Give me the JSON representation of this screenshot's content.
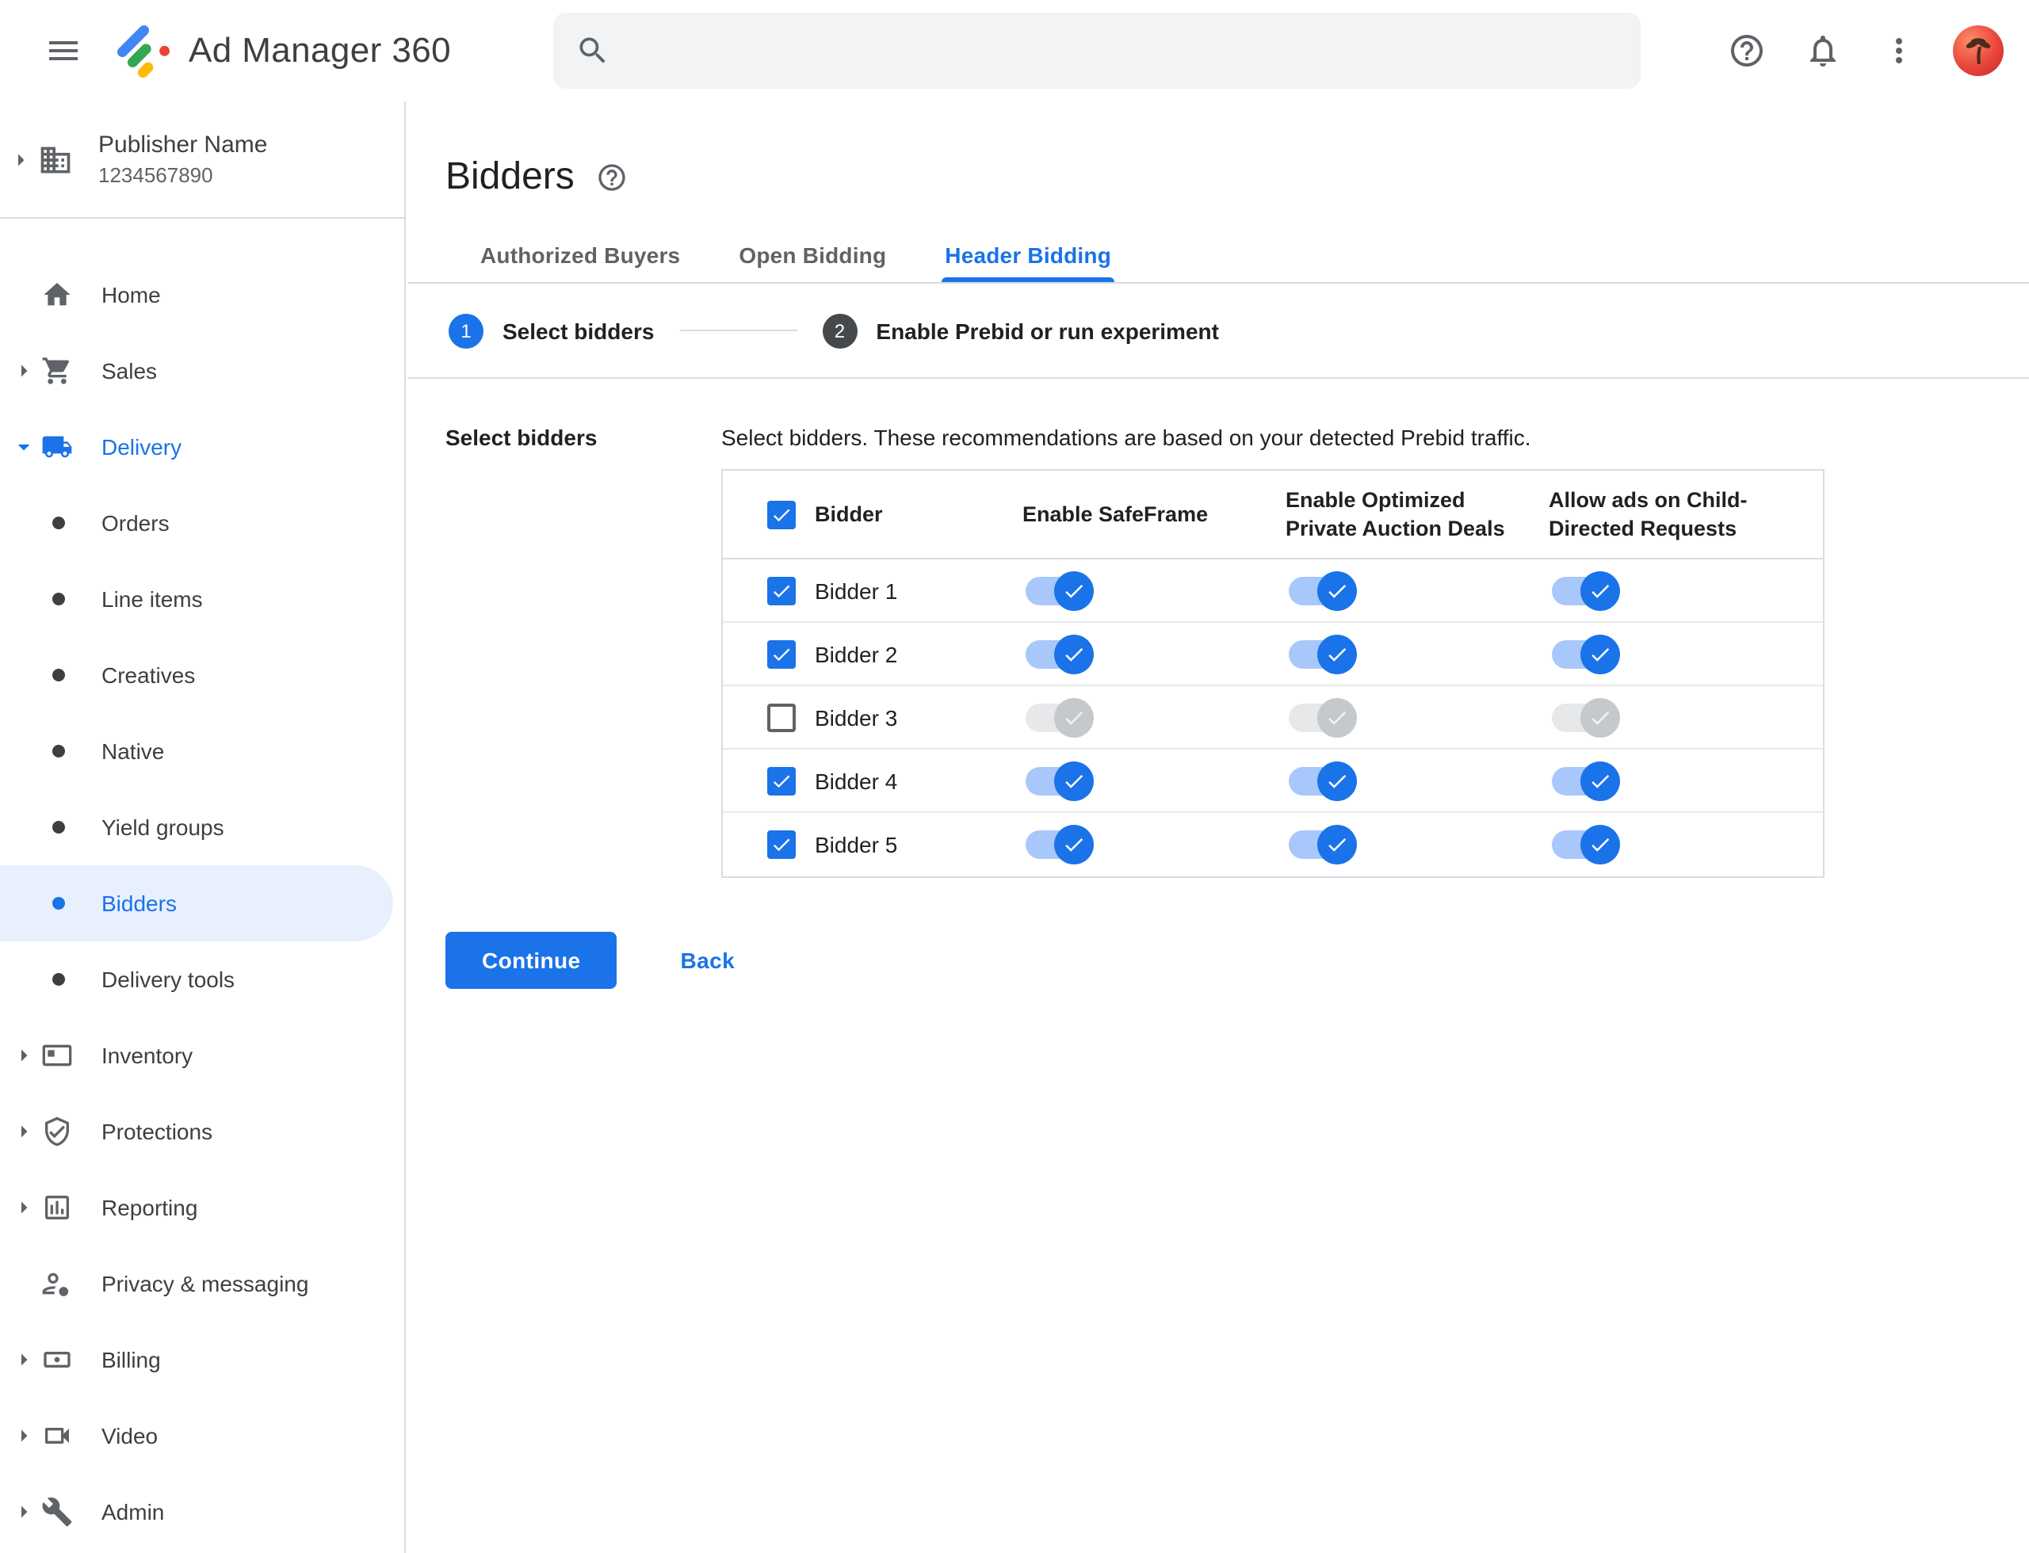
{
  "topbar": {
    "app_name": "Ad Manager 360",
    "search": {
      "placeholder": "",
      "value": ""
    }
  },
  "sidebar": {
    "publisher": {
      "name": "Publisher Name",
      "id": "1234567890"
    },
    "items": [
      {
        "label": "Home",
        "icon": "home-icon",
        "type": "item"
      },
      {
        "label": "Sales",
        "icon": "cart-icon",
        "type": "item",
        "caret": true
      },
      {
        "label": "Delivery",
        "icon": "truck-icon",
        "type": "item",
        "caret": true,
        "expanded": true,
        "active": true
      },
      {
        "label": "Orders",
        "type": "sub"
      },
      {
        "label": "Line items",
        "type": "sub"
      },
      {
        "label": "Creatives",
        "type": "sub"
      },
      {
        "label": "Native",
        "type": "sub"
      },
      {
        "label": "Yield groups",
        "type": "sub"
      },
      {
        "label": "Bidders",
        "type": "sub",
        "selected": true
      },
      {
        "label": "Delivery tools",
        "type": "sub"
      },
      {
        "label": "Inventory",
        "icon": "inventory-icon",
        "type": "item",
        "caret": true
      },
      {
        "label": "Protections",
        "icon": "shield-icon",
        "type": "item",
        "caret": true
      },
      {
        "label": "Reporting",
        "icon": "report-icon",
        "type": "item",
        "caret": true
      },
      {
        "label": "Privacy & messaging",
        "icon": "privacy-icon",
        "type": "item"
      },
      {
        "label": "Billing",
        "icon": "billing-icon",
        "type": "item",
        "caret": true
      },
      {
        "label": "Video",
        "icon": "video-icon",
        "type": "item",
        "caret": true
      },
      {
        "label": "Admin",
        "icon": "admin-icon",
        "type": "item",
        "caret": true
      }
    ]
  },
  "main": {
    "title": "Bidders",
    "tabs": [
      {
        "label": "Authorized Buyers",
        "active": false
      },
      {
        "label": "Open Bidding",
        "active": false
      },
      {
        "label": "Header Bidding",
        "active": true
      }
    ],
    "stepper": {
      "steps": [
        {
          "number": "1",
          "label": "Select bidders",
          "state": "active"
        },
        {
          "number": "2",
          "label": "Enable Prebid or run experiment",
          "state": "upcoming"
        }
      ]
    },
    "section_label": "Select bidders",
    "description": "Select bidders. These recommendations are based on your detected Prebid traffic.",
    "table": {
      "header_checkbox_checked": true,
      "columns": [
        "Bidder",
        "Enable SafeFrame",
        "Enable Optimized Private Auction Deals",
        "Allow ads on Child-Directed Requests"
      ],
      "rows": [
        {
          "name": "Bidder 1",
          "checked": true,
          "toggles": [
            true,
            true,
            true
          ]
        },
        {
          "name": "Bidder 2",
          "checked": true,
          "toggles": [
            true,
            true,
            true
          ]
        },
        {
          "name": "Bidder 3",
          "checked": false,
          "toggles": [
            false,
            false,
            false
          ]
        },
        {
          "name": "Bidder 4",
          "checked": true,
          "toggles": [
            true,
            true,
            true
          ]
        },
        {
          "name": "Bidder 5",
          "checked": true,
          "toggles": [
            true,
            true,
            true
          ]
        }
      ]
    },
    "actions": {
      "continue_label": "Continue",
      "back_label": "Back"
    }
  },
  "colors": {
    "accent_blue": "#1a73e8",
    "selected_item_bg": "#e8f0fe",
    "border": "#dadce0",
    "text_primary": "#202124",
    "text_secondary": "#5f6368",
    "toggle_on_track": "#a8c7fa",
    "toggle_off_track": "#e6e8ea",
    "toggle_off_thumb": "#c6c9cc",
    "step_upcoming_circle": "#45494c",
    "search_bg": "#f1f3f4",
    "logo_blue": "#4285f4",
    "logo_green": "#34a853",
    "logo_yellow": "#fbbc04",
    "logo_red": "#ea4335"
  }
}
